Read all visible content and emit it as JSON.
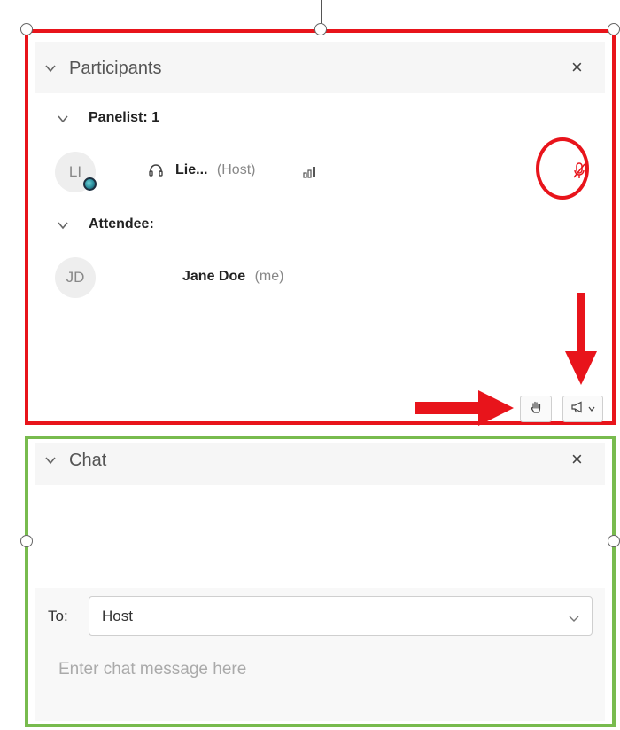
{
  "participants_panel": {
    "title": "Participants",
    "close_glyph": "×",
    "panelist_section_label": "Panelist: 1",
    "attendee_section_label": "Attendee:",
    "panelists": [
      {
        "initials": "LI",
        "status_icon": "status-globe-icon",
        "audio_icon": "headset-icon",
        "name": "Lie...",
        "role": "(Host)",
        "signal_icon": "signal-bars-icon",
        "mic_icon": "mic-muted-icon"
      }
    ],
    "attendees": [
      {
        "initials": "JD",
        "name": "Jane Doe",
        "role": "(me)"
      }
    ],
    "footer_buttons": [
      {
        "icon": "raise-hand-icon"
      },
      {
        "icon": "megaphone-icon",
        "has_dropdown": true
      }
    ]
  },
  "chat_panel": {
    "title": "Chat",
    "close_glyph": "×",
    "to_label": "To:",
    "to_value": "Host",
    "message_placeholder": "Enter chat message here"
  },
  "colors": {
    "annotation_red": "#e8141b",
    "annotation_green": "#78bb4e",
    "mic_muted_red": "#e8141b",
    "header_bg": "#f6f6f6",
    "placeholder_gray": "#aaaaaa"
  }
}
